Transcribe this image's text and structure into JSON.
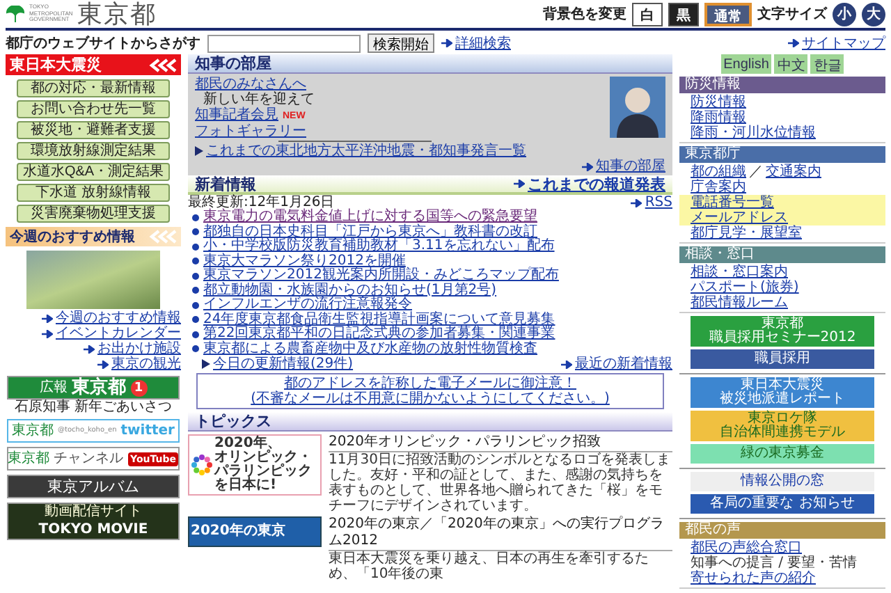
{
  "header": {
    "logo_small": [
      "TOKYO",
      "METROPOLITAN",
      "GOVERNMENT"
    ],
    "logo": "東京都",
    "bg_label": "背景色を変更",
    "bg_options": [
      {
        "label": "白",
        "kind": "white",
        "selected": false
      },
      {
        "label": "黒",
        "kind": "black",
        "selected": false
      },
      {
        "label": "通常",
        "kind": "normal",
        "selected": true
      }
    ],
    "font_label": "文字サイズ",
    "font_options": [
      "小",
      "大"
    ]
  },
  "search": {
    "label": "都庁のウェブサイトからさがす",
    "button": "検索開始",
    "advanced": "詳細検索",
    "sitemap": "サイトマップ"
  },
  "left": {
    "disaster_title": "東日本大震災",
    "disaster_buttons": [
      "都の対応・最新情報",
      "お問い合わせ先一覧",
      "被災地・避難者支援",
      "環境放射線測定結果",
      "水道水Q&A・測定結果",
      "下水道 放射線情報",
      "災害廃棄物処理支援"
    ],
    "weekly_title": "今週のおすすめ情報",
    "weekly_links": [
      "今週のおすすめ情報",
      "イベントカレンダー",
      "お出かけ施設",
      "東京の観光"
    ],
    "banners": [
      {
        "kind": "koho",
        "lines": [
          "広報",
          "東京都",
          "1"
        ],
        "caption": "石原知事 新年ごあいさつ"
      },
      {
        "kind": "twitter",
        "lines": [
          "東京都",
          "@tocho_koho_en",
          "twitter"
        ]
      },
      {
        "kind": "channel",
        "lines": [
          "東京都",
          "チャンネル",
          "YouTube"
        ]
      },
      {
        "kind": "album",
        "lines": [
          "東京アルバム"
        ]
      },
      {
        "kind": "movie",
        "lines": [
          "動画配信サイト",
          "TOKYO MOVIE"
        ]
      }
    ]
  },
  "governor": {
    "title": "知事の部屋",
    "items": [
      {
        "text": "都民のみなさんへ",
        "kind": "link"
      },
      {
        "text": "新しい年を迎えて",
        "kind": "text"
      },
      {
        "text": "知事記者会見",
        "kind": "link",
        "badge": "NEW"
      },
      {
        "text": "フォトギャラリー",
        "kind": "link"
      }
    ],
    "archive": "これまでの東北地方太平洋沖地震・都知事発言一覧",
    "more": "知事の部屋"
  },
  "news": {
    "title": "新着情報",
    "press": "これまでの報道発表",
    "updated": "最終更新:12年1月26日",
    "rss": "RSS",
    "items": [
      {
        "text": "東京電力の電気料金値上げに対する国等への緊急要望",
        "visited": true
      },
      {
        "text": "都独自の日本史科目「江戸から東京へ」教科書の改訂",
        "visited": false
      },
      {
        "text": "小・中学校版防災教育補助教材「3.11を忘れない」配布",
        "visited": false
      },
      {
        "text": "東京大マラソン祭り2012を開催",
        "visited": false
      },
      {
        "text": "東京マラソン2012観光案内所開設・みどころマップ配布",
        "visited": false
      },
      {
        "text": "都立動物園・水族園からのお知らせ(1月第2号)",
        "visited": false
      },
      {
        "text": "インフルエンザの流行注意報発令",
        "visited": false
      },
      {
        "text": "24年度東京都食品衛生監視指導計画案について意見募集",
        "visited": false
      },
      {
        "text": "第22回東京都平和の日記念式典の参加者募集・関連事業",
        "visited": false
      },
      {
        "text": "東京都による農畜産物中及び水産物の放射性物質検査",
        "visited": false
      }
    ],
    "today": "今日の更新情報(29件)",
    "recent": "最近の新着情報"
  },
  "notice": [
    "都のアドレスを詐称した電子メールに御注意！",
    "(不審なメールは不用意に開かないようにしてください。)"
  ],
  "topics": {
    "title": "トピックス",
    "items": [
      {
        "kind": "olympic",
        "image": [
          "2020年、",
          "オリンピック・",
          "パラリンピック",
          "を日本に!"
        ],
        "title": "2020年オリンピック・パラリンピック招致",
        "text": "11月30日に招致活動のシンボルとなるロゴを発表しました。友好・平和の証として、また、感謝の気持ちを表すものとして、世界各地へ贈られてきた「桜」をモチーフにデザインされています。"
      },
      {
        "kind": "plan",
        "image": [
          "2020年の東京"
        ],
        "title": "2020年の東京／「2020年の東京」への実行プログラム2012",
        "text": "東日本大震災を乗り越え、日本の再生を牽引するため、「10年後の東"
      }
    ]
  },
  "right": {
    "languages": [
      "English",
      "中文",
      "한글"
    ],
    "blocks": [
      {
        "kind": "section",
        "title": "防災情報",
        "color": "#6b5b8e",
        "items": [
          {
            "links": [
              "防災情報"
            ],
            "highlight": false
          },
          {
            "links": [
              "降雨情報"
            ],
            "highlight": false
          },
          {
            "links": [
              "降雨・河川水位情報"
            ],
            "highlight": false
          }
        ]
      },
      {
        "kind": "section",
        "title": "東京都庁",
        "color": "#4a6ea8",
        "items": [
          {
            "links": [
              "都の組織",
              "交通案内"
            ],
            "sep": "／",
            "highlight": false
          },
          {
            "links": [
              "庁舎案内"
            ],
            "highlight": false
          },
          {
            "links": [
              "電話番号一覧"
            ],
            "highlight": true
          },
          {
            "links": [
              "メールアドレス"
            ],
            "highlight": true
          },
          {
            "links": [
              "都庁見学・展望室"
            ],
            "highlight": false
          }
        ]
      },
      {
        "kind": "section",
        "title": "相談・窓口",
        "color": "#5e8a8c",
        "items": [
          {
            "links": [
              "相談・窓口案内"
            ],
            "highlight": false
          },
          {
            "links": [
              "パスポート(旅券)"
            ],
            "highlight": false
          },
          {
            "links": [
              "都民情報ルーム"
            ],
            "highlight": false
          }
        ]
      },
      {
        "kind": "banners",
        "items": [
          {
            "kind": "seminar",
            "lines": [
              "東京都",
              "職員採用セミナー2012"
            ]
          },
          {
            "kind": "recruit",
            "lines": [
              "職員採用"
            ]
          }
        ]
      },
      {
        "kind": "banners",
        "items": [
          {
            "kind": "report",
            "lines": [
              "東日本大震災",
              "被災地派遣レポート"
            ]
          },
          {
            "kind": "loca",
            "lines": [
              "東京ロケ隊",
              "自治体間連携モデル"
            ]
          },
          {
            "kind": "fund",
            "lines": [
              "緑の東京募金"
            ]
          }
        ]
      },
      {
        "kind": "banners",
        "items": [
          {
            "kind": "disclosure",
            "lines": [
              "情報公開の窓"
            ]
          },
          {
            "kind": "notice",
            "lines": [
              "各局の重要な",
              "お知らせ"
            ]
          }
        ]
      },
      {
        "kind": "section",
        "title": "都民の声",
        "color": "#b4974e",
        "items": [
          {
            "links": [
              "都民の声総合窓口"
            ],
            "highlight": false
          },
          {
            "text": "知事への提言 / 要望・苦情",
            "highlight": false
          },
          {
            "links": [
              "寄せられた声の紹介"
            ],
            "highlight": false
          }
        ]
      }
    ]
  }
}
